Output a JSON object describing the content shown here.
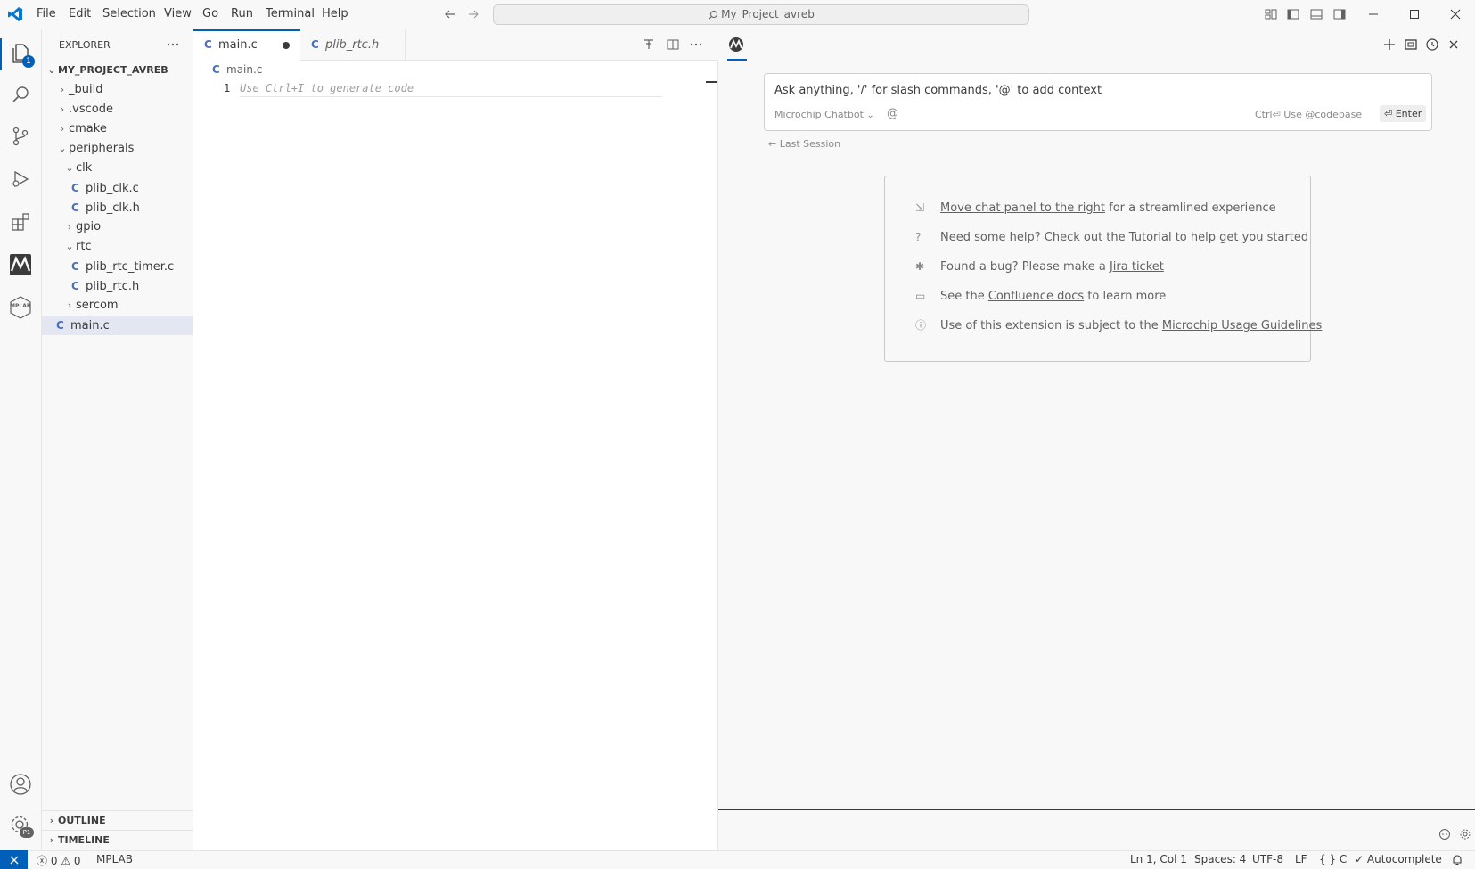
{
  "titlebar": {
    "menu": [
      "File",
      "Edit",
      "Selection",
      "View",
      "Go",
      "Run",
      "Terminal",
      "Help"
    ],
    "search_text": "My_Project_avreb"
  },
  "activitybar": {
    "explorer_badge": "1",
    "accounts_badge": "P1",
    "mplab_label": "MPLAB"
  },
  "sidebar": {
    "title": "EXPLORER",
    "project": "MY_PROJECT_AVREB",
    "items": [
      {
        "label": "_build",
        "kind": "folder",
        "expanded": false
      },
      {
        "label": ".vscode",
        "kind": "folder",
        "expanded": false
      },
      {
        "label": "cmake",
        "kind": "folder",
        "expanded": false
      },
      {
        "label": "peripherals",
        "kind": "folder",
        "expanded": true
      },
      {
        "label": "clk",
        "kind": "folder",
        "expanded": true
      },
      {
        "label": "plib_clk.c",
        "kind": "file"
      },
      {
        "label": "plib_clk.h",
        "kind": "file"
      },
      {
        "label": "gpio",
        "kind": "folder",
        "expanded": false
      },
      {
        "label": "rtc",
        "kind": "folder",
        "expanded": true
      },
      {
        "label": "plib_rtc_timer.c",
        "kind": "file"
      },
      {
        "label": "plib_rtc.h",
        "kind": "file"
      },
      {
        "label": "sercom",
        "kind": "folder",
        "expanded": false
      },
      {
        "label": "main.c",
        "kind": "file"
      }
    ],
    "outline": "OUTLINE",
    "timeline": "TIMELINE"
  },
  "editor": {
    "tabs": [
      {
        "label": "main.c",
        "active": true,
        "dirty": true
      },
      {
        "label": "plib_rtc.h",
        "active": false,
        "dirty": false
      }
    ],
    "breadcrumb": "main.c",
    "line_number": "1",
    "placeholder": "Use Ctrl+I to generate code"
  },
  "chat": {
    "input_placeholder": "Ask anything, '/' for slash commands, '@' to add context",
    "model": "Microchip Chatbot",
    "at_symbol": "@",
    "codebase_hint": "Ctrl⏎ Use @codebase",
    "enter_label": "⏎ Enter",
    "last_session": "Last Session",
    "info": [
      {
        "icon": "move-panel-icon",
        "pre": "",
        "link": "Move chat panel to the right",
        "post": " for a streamlined experience"
      },
      {
        "icon": "help-icon",
        "pre": "Need some help? ",
        "link": "Check out the Tutorial",
        "post": " to help get you started"
      },
      {
        "icon": "bug-icon",
        "pre": "Found a bug? Please make a ",
        "link": "Jira ticket",
        "post": ""
      },
      {
        "icon": "book-icon",
        "pre": "See the ",
        "link": "Confluence docs",
        "post": " to learn more"
      },
      {
        "icon": "info-icon",
        "pre": "Use of this extension is subject to the ",
        "link": "Microchip Usage Guidelines",
        "post": ""
      }
    ]
  },
  "statusbar": {
    "errors": "0",
    "warnings": "0",
    "mplab": "MPLAB",
    "position": "Ln 1, Col 1",
    "spaces": "Spaces: 4",
    "encoding": "UTF-8",
    "eol": "LF",
    "language": "C",
    "autocomplete": "Autocomplete"
  }
}
